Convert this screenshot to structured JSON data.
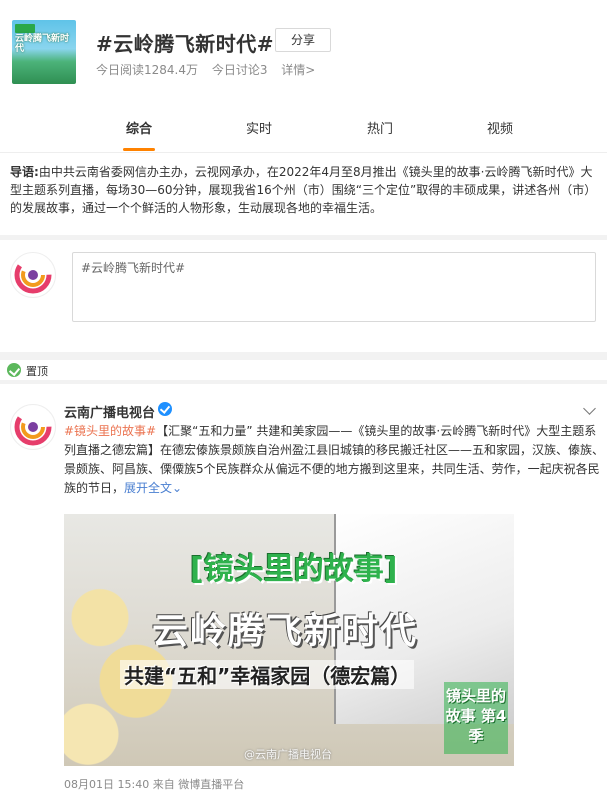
{
  "header": {
    "cover": {
      "title": "云岭腾飞新时代",
      "label": "镜"
    },
    "title": "#云岭腾飞新时代#",
    "share_label": "分享",
    "read_count": "今日阅读1284.4万",
    "discuss_count": "今日讨论3",
    "details_link": "详情>"
  },
  "tabs": [
    {
      "label": "综合",
      "active": true
    },
    {
      "label": "实时",
      "active": false
    },
    {
      "label": "热门",
      "active": false
    },
    {
      "label": "视频",
      "active": false
    }
  ],
  "intro": {
    "label": "导语:",
    "text": "由中共云南省委网信办主办，云视网承办，在2022年4月至8月推出《镜头里的故事·云岭腾飞新时代》大型主题系列直播，每场30—60分钟，展现我省16个州（市）围绕“三个定位”取得的丰硕成果，讲述各州（市）的发展故事，通过一个个鲜活的人物形象，生动展现各地的幸福生活。"
  },
  "composer": {
    "text": "#云岭腾飞新时代#"
  },
  "pinned_label": "置顶",
  "post": {
    "author": "云南广播电视台",
    "hashtag": "#镜头里的故事#",
    "text": "【汇聚“五和力量” 共建和美家园——《镜头里的故事·云岭腾飞新时代》大型主题系列直播之德宏篇】在德宏傣族景颇族自治州盈江县旧城镇的移民搬迁社区——五和家园，汉族、傣族、景颇族、阿昌族、傈僳族5个民族群众从偏远不便的地方搬到这里来，共同生活、劳作，一起庆祝各民族的节日，",
    "expand_label": "展开全文",
    "image": {
      "title1": "[镜头里的故事]",
      "season": "第四季",
      "title2": "云岭腾飞新时代",
      "title3": "共建“五和”幸福家园（德宏篇）",
      "badge": "镜头里的故事 第4季",
      "watermark": "@云南广播电视台"
    },
    "timestamp": "08月01日 15:40",
    "source": "来自 微博直播平台"
  }
}
